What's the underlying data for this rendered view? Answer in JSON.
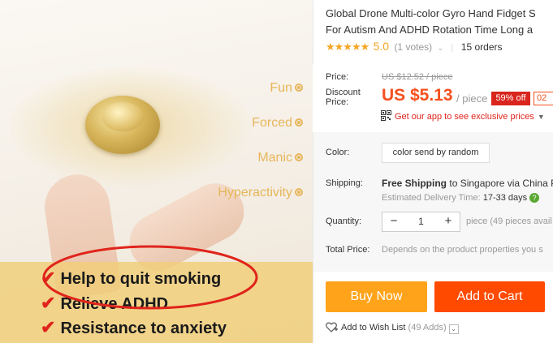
{
  "product_image": {
    "features": [
      "Fun",
      "Forced",
      "Manic",
      "Hyperactivity"
    ],
    "benefits": [
      "Help to quit smoking",
      "Relieve ADHD",
      "Resistance to anxiety"
    ]
  },
  "product": {
    "title_line1": "Global Drone Multi-color Gyro Hand Fidget S",
    "title_line2": "For Autism And ADHD Rotation Time Long a",
    "stars": "★★★★★",
    "rating": "5.0",
    "votes": "(1 votes)",
    "orders": "15 orders"
  },
  "price": {
    "price_label": "Price:",
    "discount_label": "Discount Price:",
    "original": "US $12.52 / piece",
    "discounted": "US $5.13",
    "unit": "/ piece",
    "discount_badge": "59% off",
    "timer_badge": "02",
    "app_promo": "Get our app to see exclusive prices"
  },
  "options": {
    "color_label": "Color:",
    "color_value": "color send by random",
    "shipping_label": "Shipping:",
    "shipping_free": "Free Shipping",
    "shipping_rest": "to Singapore via China P",
    "delivery_prefix": "Estimated Delivery Time:",
    "delivery_days": "17-33 days",
    "quantity_label": "Quantity:",
    "quantity_value": "1",
    "stock": "piece (49 pieces avail",
    "total_label": "Total Price:",
    "total_text": "Depends on the product properties you s"
  },
  "actions": {
    "buy_now": "Buy Now",
    "add_to_cart": "Add to Cart",
    "wishlist": "Add to Wish List",
    "wish_count": "(49 Adds)"
  },
  "colors": {
    "price_orange": "#f5501e",
    "buy_now_bg": "#ffa31a",
    "add_cart_bg": "#ff4a00",
    "discount_badge_bg": "#d9251d",
    "star_color": "#f5a623"
  }
}
